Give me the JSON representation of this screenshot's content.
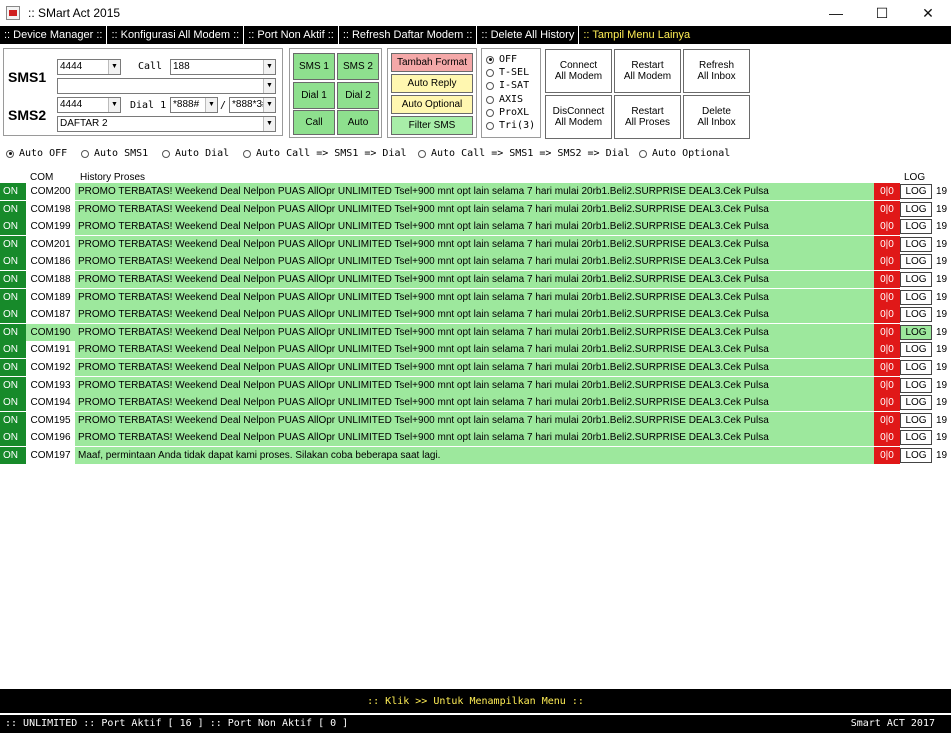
{
  "window": {
    "title": ":: SMart Act 2015",
    "minimize": "—",
    "maximize": "☐",
    "close": "✕"
  },
  "menu": [
    ":: Device Manager ::",
    ":: Konfigurasi All Modem ::",
    ":: Port Non Aktif ::",
    ":: Refresh Daftar Modem ::",
    ":: Delete All History",
    ":: Tampil Menu Lainya"
  ],
  "controls": {
    "sms1_label": "SMS1",
    "sms2_label": "SMS2",
    "sms1_number": "4444",
    "call_label": "Call",
    "call_number": "188",
    "sms1_text": "",
    "sms2_number": "4444",
    "dial1_label": "Dial 1",
    "dial1_code": "*888#",
    "dial_sep": "/",
    "dial2_code": "*888*3#",
    "sms2_text": "DAFTAR 2"
  },
  "green_buttons": {
    "sms1": "SMS 1",
    "sms2": "SMS 2",
    "dial1": "Dial 1",
    "dial2": "Dial 2",
    "call": "Call",
    "auto": "Auto"
  },
  "format_buttons": {
    "tambah": "Tambah Format",
    "reply": "Auto Reply",
    "optional": "Auto Optional",
    "filter": "Filter SMS"
  },
  "operators": {
    "options": [
      "OFF",
      "T-SEL",
      "I-SAT",
      "AXIS",
      "ProXL",
      "Tri(3)"
    ],
    "selected": "OFF"
  },
  "modem_buttons": {
    "connect": "Connect\nAll Modem",
    "restart_modem": "Restart\nAll Modem",
    "refresh_inbox": "Refresh\nAll Inbox",
    "disconnect": "DisConnect\nAll Modem",
    "restart_proses": "Restart\nAll Proses",
    "delete_inbox": "Delete\nAll Inbox"
  },
  "auto_modes": {
    "options": [
      "Auto OFF",
      "Auto SMS1",
      "Auto Dial",
      "Auto Call => SMS1 => Dial",
      "Auto Call => SMS1 => SMS2 => Dial",
      "Auto Optional"
    ],
    "selected": "Auto OFF"
  },
  "table": {
    "headers": {
      "com": "COM",
      "history": "History Proses",
      "log": "LOG"
    },
    "rows": [
      {
        "status": "ON",
        "com": "COM200",
        "history": "PROMO TERBATAS! Weekend Deal Nelpon PUAS AllOpr UNLIMITED Tsel+900 mnt opt lain selama 7 hari mulai 20rb1.Beli2.SURPRISE DEAL3.Cek Pulsa",
        "count": "0|0",
        "log": "LOG",
        "tail": "19"
      },
      {
        "status": "ON",
        "com": "COM198",
        "history": "PROMO TERBATAS! Weekend Deal Nelpon PUAS AllOpr UNLIMITED Tsel+900 mnt opt lain selama 7 hari mulai 20rb1.Beli2.SURPRISE DEAL3.Cek Pulsa",
        "count": "0|0",
        "log": "LOG",
        "tail": "19"
      },
      {
        "status": "ON",
        "com": "COM199",
        "history": "PROMO TERBATAS! Weekend Deal Nelpon PUAS AllOpr UNLIMITED Tsel+900 mnt opt lain selama 7 hari mulai 20rb1.Beli2.SURPRISE DEAL3.Cek Pulsa",
        "count": "0|0",
        "log": "LOG",
        "tail": "19"
      },
      {
        "status": "ON",
        "com": "COM201",
        "history": "PROMO TERBATAS! Weekend Deal Nelpon PUAS AllOpr UNLIMITED Tsel+900 mnt opt lain selama 7 hari mulai 20rb1.Beli2.SURPRISE DEAL3.Cek Pulsa",
        "count": "0|0",
        "log": "LOG",
        "tail": "19"
      },
      {
        "status": "ON",
        "com": "COM186",
        "history": "PROMO TERBATAS! Weekend Deal Nelpon PUAS AllOpr UNLIMITED Tsel+900 mnt opt lain selama 7 hari mulai 20rb1.Beli2.SURPRISE DEAL3.Cek Pulsa",
        "count": "0|0",
        "log": "LOG",
        "tail": "19"
      },
      {
        "status": "ON",
        "com": "COM188",
        "history": "PROMO TERBATAS! Weekend Deal Nelpon PUAS AllOpr UNLIMITED Tsel+900 mnt opt lain selama 7 hari mulai 20rb1.Beli2.SURPRISE DEAL3.Cek Pulsa",
        "count": "0|0",
        "log": "LOG",
        "tail": "19"
      },
      {
        "status": "ON",
        "com": "COM189",
        "history": "PROMO TERBATAS! Weekend Deal Nelpon PUAS AllOpr UNLIMITED Tsel+900 mnt opt lain selama 7 hari mulai 20rb1.Beli2.SURPRISE DEAL3.Cek Pulsa",
        "count": "0|0",
        "log": "LOG",
        "tail": "19"
      },
      {
        "status": "ON",
        "com": "COM187",
        "history": "PROMO TERBATAS! Weekend Deal Nelpon PUAS AllOpr UNLIMITED Tsel+900 mnt opt lain selama 7 hari mulai 20rb1.Beli2.SURPRISE DEAL3.Cek Pulsa",
        "count": "0|0",
        "log": "LOG",
        "tail": "19"
      },
      {
        "status": "ON",
        "com": "COM190",
        "history": "PROMO TERBATAS! Weekend Deal Nelpon PUAS AllOpr UNLIMITED Tsel+900 mnt opt lain selama 7 hari mulai 20rb1.Beli2.SURPRISE DEAL3.Cek Pulsa",
        "count": "0|0",
        "log": "LOG",
        "tail": "19",
        "selected": true
      },
      {
        "status": "ON",
        "com": "COM191",
        "history": "PROMO TERBATAS! Weekend Deal Nelpon PUAS AllOpr UNLIMITED Tsel+900 mnt opt lain selama 7 hari mulai 20rb1.Beli2.SURPRISE DEAL3.Cek Pulsa",
        "count": "0|0",
        "log": "LOG",
        "tail": "19"
      },
      {
        "status": "ON",
        "com": "COM192",
        "history": "PROMO TERBATAS! Weekend Deal Nelpon PUAS AllOpr UNLIMITED Tsel+900 mnt opt lain selama 7 hari mulai 20rb1.Beli2.SURPRISE DEAL3.Cek Pulsa",
        "count": "0|0",
        "log": "LOG",
        "tail": "19"
      },
      {
        "status": "ON",
        "com": "COM193",
        "history": "PROMO TERBATAS! Weekend Deal Nelpon PUAS AllOpr UNLIMITED Tsel+900 mnt opt lain selama 7 hari mulai 20rb1.Beli2.SURPRISE DEAL3.Cek Pulsa",
        "count": "0|0",
        "log": "LOG",
        "tail": "19"
      },
      {
        "status": "ON",
        "com": "COM194",
        "history": "PROMO TERBATAS! Weekend Deal Nelpon PUAS AllOpr UNLIMITED Tsel+900 mnt opt lain selama 7 hari mulai 20rb1.Beli2.SURPRISE DEAL3.Cek Pulsa",
        "count": "0|0",
        "log": "LOG",
        "tail": "19"
      },
      {
        "status": "ON",
        "com": "COM195",
        "history": "PROMO TERBATAS! Weekend Deal Nelpon PUAS AllOpr UNLIMITED Tsel+900 mnt opt lain selama 7 hari mulai 20rb1.Beli2.SURPRISE DEAL3.Cek Pulsa",
        "count": "0|0",
        "log": "LOG",
        "tail": "19"
      },
      {
        "status": "ON",
        "com": "COM196",
        "history": "PROMO TERBATAS! Weekend Deal Nelpon PUAS AllOpr UNLIMITED Tsel+900 mnt opt lain selama 7 hari mulai 20rb1.Beli2.SURPRISE DEAL3.Cek Pulsa",
        "count": "0|0",
        "log": "LOG",
        "tail": "19"
      },
      {
        "status": "ON",
        "com": "COM197",
        "history": "Maaf, permintaan Anda tidak dapat kami proses. Silakan coba beberapa saat lagi.",
        "count": "0|0",
        "log": "LOG",
        "tail": "19"
      }
    ]
  },
  "footer": {
    "klik": ":: Klik >> Untuk Menampilkan Menu ::",
    "status_left": ":: UNLIMITED :: Port Aktif [ 16 ] :: Port Non Aktif [ 0 ]",
    "status_right": "Smart ACT 2017"
  },
  "colors": {
    "status_on": "#178a2a",
    "history_bg": "#9de89d",
    "count_bg": "#e01818",
    "menubar_bg": "#000000",
    "menu_highlight": "#ffee55"
  }
}
